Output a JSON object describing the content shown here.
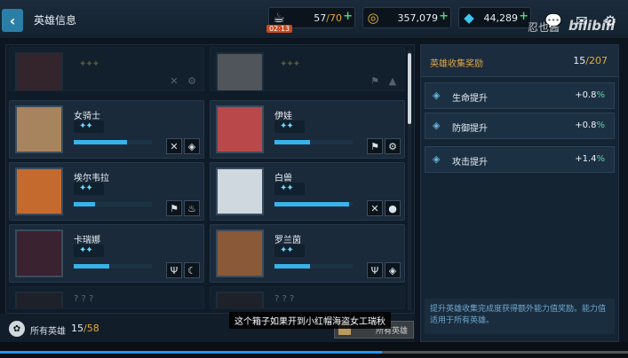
{
  "header": {
    "title": "英雄信息",
    "stamina_current": "57",
    "stamina_max": "70",
    "stamina_timer": "02:13",
    "gold": "357,079",
    "gems": "44,289"
  },
  "watermark": "忍也酱",
  "watermark_brand": "bilibili",
  "heroes": [
    {
      "name": "",
      "stars": "✦✦✦",
      "progress": 0.0,
      "icons": [
        "crossed-swords-icon",
        "gear-icon"
      ],
      "dim": true
    },
    {
      "name": "",
      "stars": "✦✦✦",
      "progress": 0.0,
      "icons": [
        "flag-icon",
        "mountain-icon"
      ],
      "dim": true
    },
    {
      "name": "女骑士",
      "stars": "✦✦",
      "progress": 0.68,
      "icons": [
        "crossed-swords-icon",
        "diamond-icon"
      ],
      "dim": false
    },
    {
      "name": "伊娃",
      "stars": "✦✦",
      "progress": 0.45,
      "icons": [
        "flag-icon",
        "gear-icon"
      ],
      "dim": false
    },
    {
      "name": "埃尔韦拉",
      "stars": "✦✦",
      "progress": 0.27,
      "icons": [
        "flag-icon",
        "fire-icon"
      ],
      "dim": false
    },
    {
      "name": "白兽",
      "stars": "✦✦",
      "progress": 0.95,
      "icons": [
        "crossed-swords-icon",
        "water-drop-icon"
      ],
      "dim": false
    },
    {
      "name": "卡瑞娜",
      "stars": "✦✦",
      "progress": 0.45,
      "icons": [
        "trident-icon",
        "moon-icon"
      ],
      "dim": false
    },
    {
      "name": "罗兰茵",
      "stars": "✦✦",
      "progress": 0.45,
      "icons": [
        "trident-icon",
        "diamond-icon"
      ],
      "dim": false
    },
    {
      "name": "? ? ?",
      "stars": "",
      "progress": 0.0,
      "icons": [],
      "dim": true
    },
    {
      "name": "? ? ?",
      "stars": "",
      "progress": 0.0,
      "icons": [],
      "dim": true
    }
  ],
  "footer": {
    "all_label": "所有英雄",
    "count": "15",
    "max": "58",
    "filter_label": "所有英雄"
  },
  "subtitle": "这个箱子如果开到小红帽海盗女工瑞秋",
  "bonus": {
    "title": "英雄收集奖励",
    "count": "15",
    "max": "207",
    "rows": [
      {
        "label": "生命提升",
        "value": "+0.8",
        "pct": "%"
      },
      {
        "label": "防御提升",
        "value": "+0.8",
        "pct": "%"
      },
      {
        "label": "攻击提升",
        "value": "+1.4",
        "pct": "%"
      }
    ],
    "note": "提升英雄收集完成度获得额外能力值奖励。能力值适用于所有英雄。"
  }
}
